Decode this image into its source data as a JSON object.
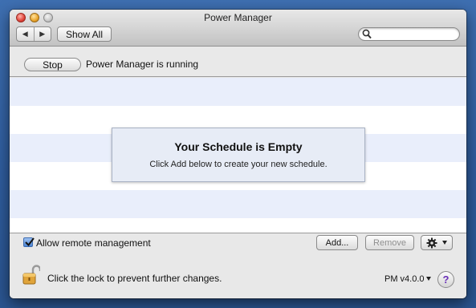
{
  "window": {
    "title": "Power Manager"
  },
  "toolbar": {
    "back_icon": "back-arrow-icon",
    "forward_icon": "forward-arrow-icon",
    "back_glyph": "◀",
    "forward_glyph": "▶",
    "show_all_label": "Show All",
    "search_placeholder": "",
    "search_value": ""
  },
  "status": {
    "stop_label": "Stop",
    "message": "Power Manager is running"
  },
  "schedule": {
    "empty_title": "Your Schedule is Empty",
    "empty_subtitle": "Click Add below to create your new schedule."
  },
  "controls": {
    "allow_remote_label": "Allow remote management",
    "allow_remote_checked": true,
    "add_label": "Add...",
    "remove_label": "Remove",
    "gear_icon": "gear-icon",
    "gear_dropdown_icon": "chevron-down-icon"
  },
  "footer": {
    "lock_icon": "padlock-open-icon",
    "lock_text": "Click the lock to prevent further changes.",
    "version_label": "PM v4.0.0",
    "help_label": "?"
  },
  "colors": {
    "desktop": "#3e6fb1",
    "stripe": "#e9eefb",
    "empty_box": "#e7ecf6",
    "help_accent": "#6a2fb8",
    "checkbox": "#4b85d3"
  }
}
